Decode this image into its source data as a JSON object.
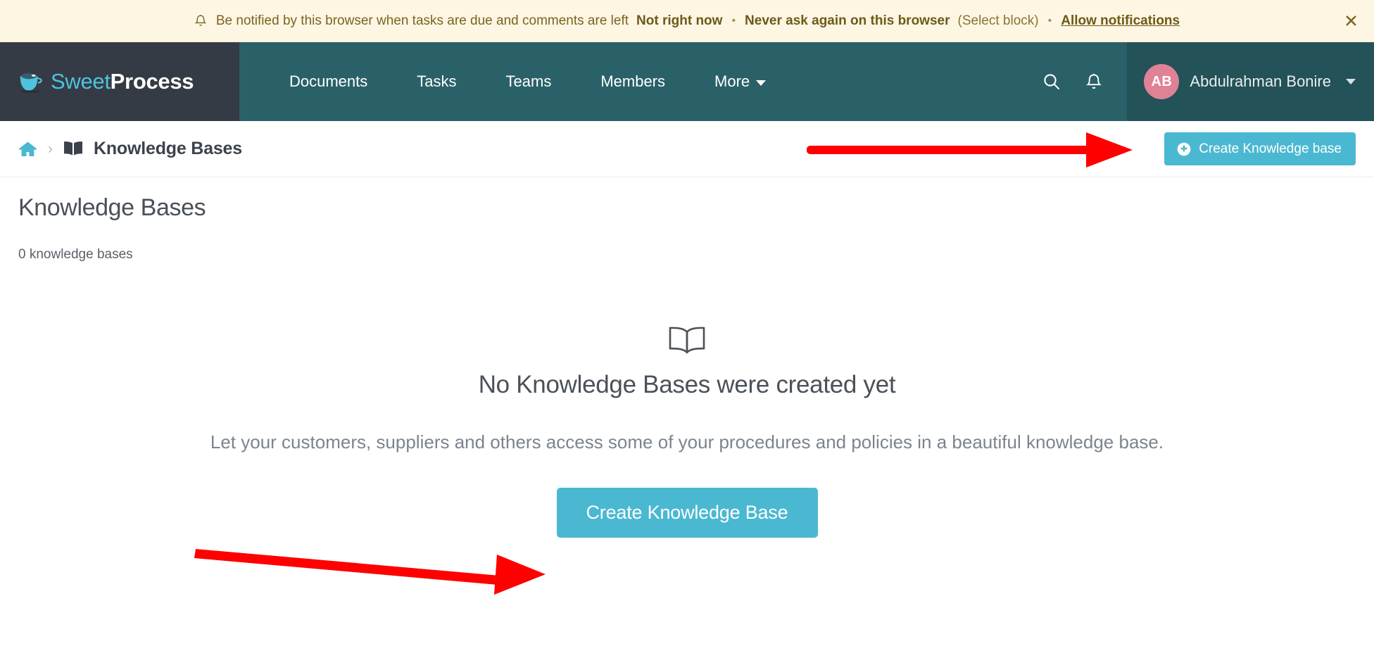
{
  "notification": {
    "icon": "bell-icon",
    "message": "Be notified by this browser when tasks are due and comments are left",
    "action_not_now": "Not right now",
    "separator": "•",
    "action_never": "Never ask again on this browser",
    "action_never_hint": "(Select block)",
    "action_allow": "Allow notifications",
    "close_label": "✕",
    "background": "#fdf6e3",
    "text_color": "#7a6420"
  },
  "navbar": {
    "brand": {
      "icon": "coffee-cup-icon",
      "text_light": "Sweet",
      "text_bold": "Process",
      "background": "#353b45",
      "accent": "#4ec3dd"
    },
    "background": "#2a6169",
    "items": [
      {
        "label": "Documents",
        "has_caret": false
      },
      {
        "label": "Tasks",
        "has_caret": false
      },
      {
        "label": "Teams",
        "has_caret": false
      },
      {
        "label": "Members",
        "has_caret": false
      },
      {
        "label": "More",
        "has_caret": true
      }
    ],
    "search_icon": "search-icon",
    "notifications_icon": "bell-icon",
    "user": {
      "initials": "AB",
      "name": "Abdulrahman Bonire",
      "avatar_color": "#e08296",
      "background": "#235258"
    }
  },
  "breadcrumb": {
    "home_icon": "home-icon",
    "separator": "›",
    "book_icon": "book-icon",
    "label": "Knowledge Bases",
    "create_button": {
      "icon": "plus-circle-icon",
      "label": "Create Knowledge base",
      "color": "#4bb8d2"
    }
  },
  "main": {
    "title": "Knowledge Bases",
    "count_text": "0 knowledge bases",
    "empty_state": {
      "icon": "open-book-icon",
      "title": "No Knowledge Bases were created yet",
      "description": "Let your customers, suppliers and others access some of your procedures and policies in a beautiful knowledge base.",
      "cta_label": "Create Knowledge Base",
      "cta_color": "#4bb8d2"
    }
  },
  "annotations": {
    "color": "#fe0000",
    "arrow_top": "arrow-pointing-to-create-knowledge-base-button",
    "arrow_bottom": "arrow-pointing-to-create-knowledge-base-cta"
  }
}
